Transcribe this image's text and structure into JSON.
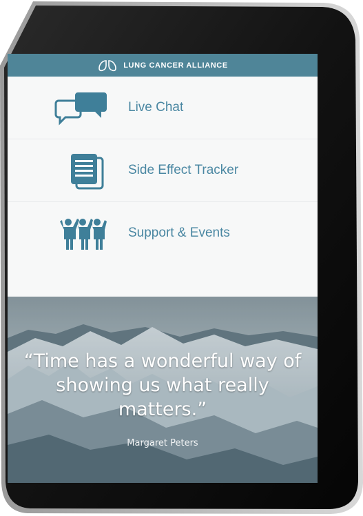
{
  "app": {
    "brand_name": "LUNG CANCER ALLIANCE",
    "brand_logo_icon": "lungs-icon",
    "brand_color": "#4f8598",
    "accent_color": "#4a87a2"
  },
  "menu": {
    "items": [
      {
        "label": "Live Chat",
        "icon": "chat-bubbles-icon"
      },
      {
        "label": "Side Effect Tracker",
        "icon": "documents-icon"
      },
      {
        "label": "Support & Events",
        "icon": "people-group-icon"
      }
    ]
  },
  "quote": {
    "text": "“Time has a wonderful way of showing us what really matters.”",
    "author": "Margaret Peters",
    "background": "snowy-mountains-image"
  }
}
